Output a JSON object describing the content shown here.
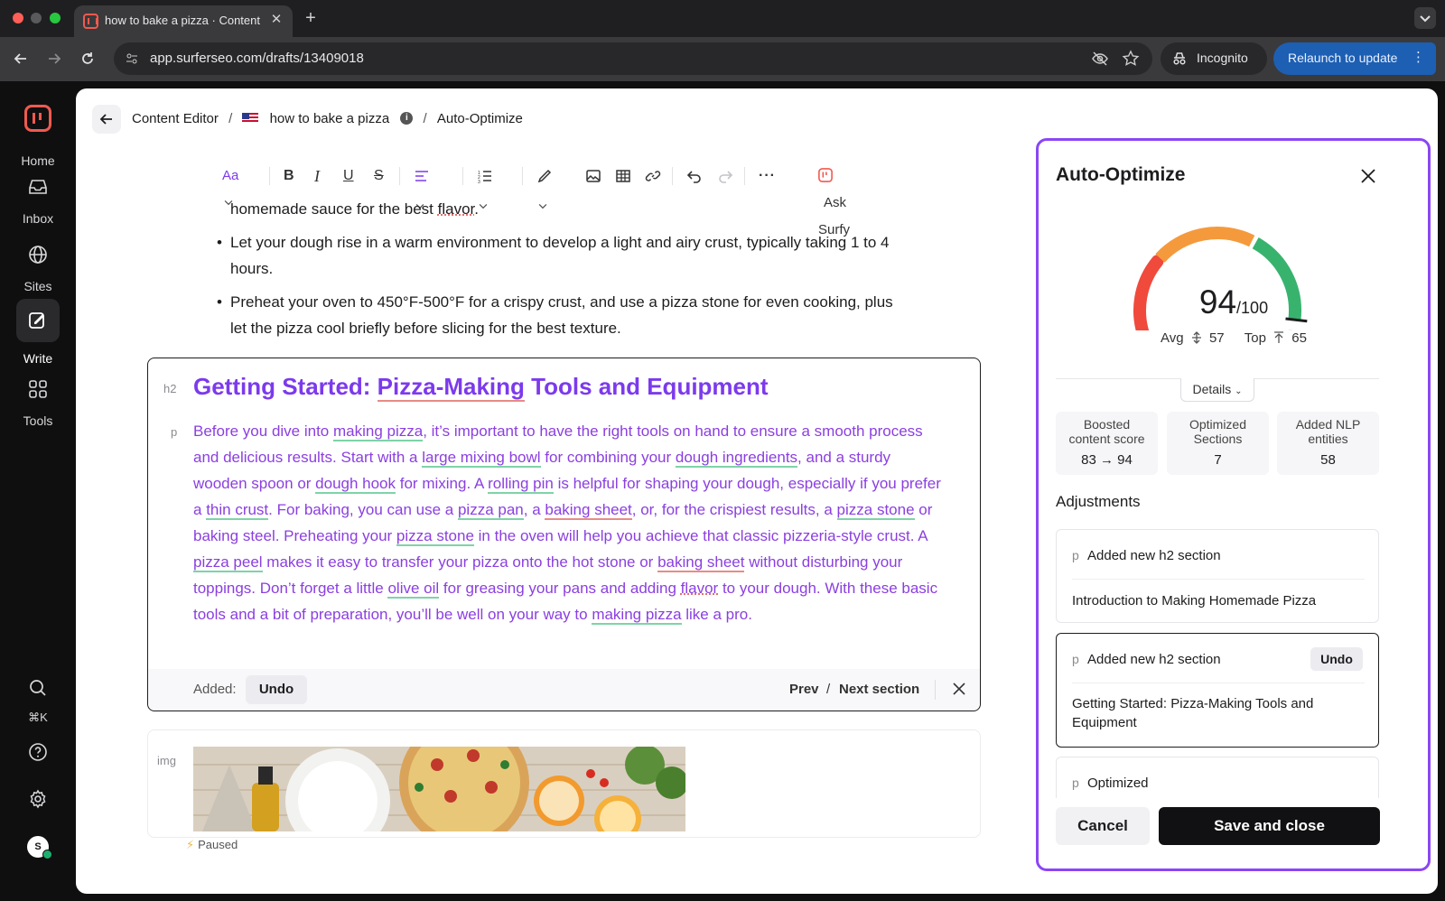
{
  "browser": {
    "tab_title": "how to bake a pizza · Content Editor",
    "url": "app.surferseo.com/drafts/13409018",
    "incognito_label": "Incognito",
    "relaunch_label": "Relaunch to update"
  },
  "rail": {
    "home": "Home",
    "inbox": "Inbox",
    "sites": "Sites",
    "write": "Write",
    "tools": "Tools",
    "search_shortcut": "⌘K",
    "avatar_initial": "S"
  },
  "breadcrumb": {
    "root": "Content Editor",
    "doc": "how to bake a pizza",
    "current": "Auto-Optimize",
    "sep": "/"
  },
  "editor_toolbar": {
    "font_label": "Aa",
    "ask_surfy": "Ask Surfy"
  },
  "content": {
    "line_intro": [
      "homemade sauce for the best ",
      "flavor",
      "."
    ],
    "bullet_1": [
      "Let your dough rise in a warm environment to develop a light and airy crust, typically taking 1 to 4",
      "hours."
    ],
    "bullet_2": [
      "Preheat your oven to 450°F-500°F for a crispy crust, and use a pizza stone for even cooking, plus",
      "let the pizza cool briefly before slicing for the best texture."
    ]
  },
  "section": {
    "h2_tag": "h2",
    "p_tag": "p",
    "h2_parts": [
      "Getting Started: ",
      "Pizza-Making",
      " Tools and Equipment"
    ],
    "p_parts": [
      "Before you dive into ",
      "making pizza",
      ", it’s important to have the right tools on hand to ensure a smooth process and delicious results. Start with a ",
      "large mixing bowl",
      " for combining your ",
      "dough ingredients",
      ", and a sturdy wooden spoon or ",
      "dough hook",
      " for mixing. A ",
      "rolling pin",
      " is helpful for shaping your dough, especially if you prefer a ",
      "thin crust",
      ". For baking, you can use a ",
      "pizza pan",
      ", a ",
      "baking sheet",
      ", or, for the crispiest results, a ",
      "pizza stone",
      " or baking steel. Preheating your ",
      "pizza stone",
      " in the oven will help you achieve that classic pizzeria-style crust. A ",
      "pizza peel",
      " makes it easy to transfer your pizza onto the hot stone or ",
      "baking sheet",
      " without disturbing your toppings. Don’t forget a little ",
      "olive oil",
      " for greasing your pans and adding ",
      "flavor",
      " to your dough. With these basic tools and a bit of preparation, you’ll be well on your way to ",
      "making pizza",
      " like a pro."
    ],
    "added_label": "Added:",
    "undo": "Undo",
    "prev": "Prev",
    "slash": "/",
    "next": "Next section"
  },
  "image_block": {
    "tag": "img",
    "paused": "Paused"
  },
  "panel": {
    "title": "Auto-Optimize",
    "score": "94",
    "score_max": "/100",
    "score_value": 94,
    "avg_label": "Avg",
    "avg_value": "57",
    "top_label": "Top",
    "top_value": "65",
    "details": "Details",
    "stats": [
      {
        "label": "Boosted content score",
        "value": "83 → 94"
      },
      {
        "label": "Optimized Sections",
        "value": "7"
      },
      {
        "label": "Added NLP entities",
        "value": "58"
      }
    ],
    "adjustments_title": "Adjustments",
    "adjustments": [
      {
        "tag": "p",
        "head": "Added new h2 section",
        "body": "Introduction to Making Homemade Pizza"
      },
      {
        "tag": "p",
        "head": "Added new h2 section",
        "body": "Getting Started: Pizza-Making Tools and Equipment",
        "undo": "Undo"
      },
      {
        "tag": "p",
        "head": "Optimized"
      }
    ],
    "cancel": "Cancel",
    "save": "Save and close"
  },
  "colors": {
    "accent_purple": "#8b46f5",
    "section_text": "#8b3fe0",
    "gauge_red": "#f04a3c",
    "gauge_orange": "#f59a3c",
    "gauge_green": "#38b36e",
    "surfer_red": "#f05a4f"
  }
}
